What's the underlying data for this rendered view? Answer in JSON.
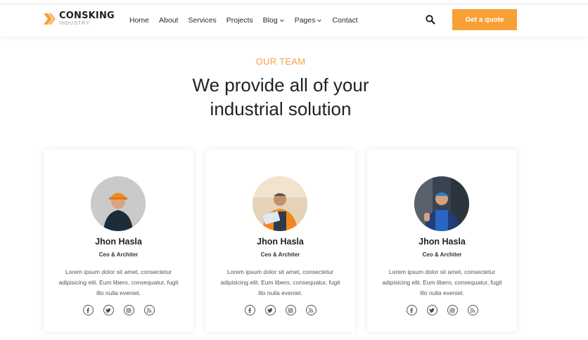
{
  "header": {
    "logo_name": "CONSKING",
    "logo_sub": "INDUSTRY",
    "menu": [
      {
        "label": "Home"
      },
      {
        "label": "About"
      },
      {
        "label": "Services"
      },
      {
        "label": "Projects"
      },
      {
        "label": "Blog"
      },
      {
        "label": "Pages"
      },
      {
        "label": "Contact"
      }
    ],
    "cta_label": "Get a quote"
  },
  "section": {
    "eyebrow": "OUR TEAM",
    "title_line1": "We provide all of your",
    "title_line2": "industrial solution"
  },
  "team": [
    {
      "name": "Jhon Hasla",
      "role": "Ceo & Architer",
      "bio": "Lorem ipsum dolor sit amet, consectetur adipisicing elit. Eum libero, consequatur, fugit illo nulla eveniet."
    },
    {
      "name": "Jhon Hasla",
      "role": "Ceo & Architer",
      "bio": "Lorem ipsum dolor sit amet, consectetur adipisicing elit. Eum libero, consequatur, fugit illo nulla eveniet."
    },
    {
      "name": "Jhon Hasla",
      "role": "Ceo & Architer",
      "bio": "Lorem ipsum dolor sit amet, consectetur adipisicing elit. Eum libero, consequatur, fugit illo nulla eveniet."
    }
  ],
  "social_icons": [
    "facebook-icon",
    "twitter-icon",
    "instagram-icon",
    "rss-icon"
  ],
  "colors": {
    "accent": "#f7a035",
    "eyebrow": "#f4a145",
    "text": "#222222"
  }
}
